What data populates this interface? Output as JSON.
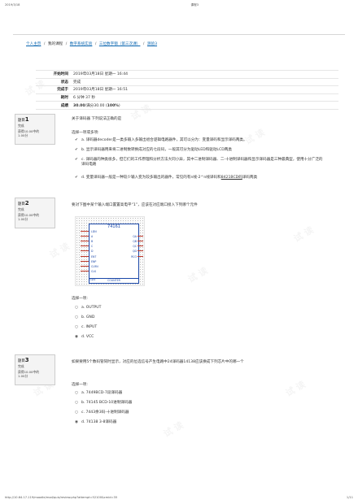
{
  "print": {
    "date": "2019/3/18",
    "doc_title": "课程3",
    "url": "http://10.64.17.119/moodle/mod/quiz/review.php?attempt=52100&cmid=35",
    "page_no": "1/11"
  },
  "breadcrumb": {
    "home": "个人主页",
    "my_courses": "我的课程",
    "course": "数字系统实验",
    "section": "三位数字锁（第三次课）",
    "quiz": "测验3",
    "sep": "/"
  },
  "summary": [
    {
      "label": "开始时间",
      "value": "2019年03月18日 星期一 16:44"
    },
    {
      "label": "状态",
      "value": "完成"
    },
    {
      "label": "完成于",
      "value": "2019年03月18日 星期一 16:51"
    },
    {
      "label": "耗时",
      "value": "6 分钟 37 秒"
    },
    {
      "label": "成绩",
      "value_bold": "30.00",
      "value_mid": "/满分30.00 (",
      "value_pct": "100%",
      "value_end": ")"
    }
  ],
  "questions": [
    {
      "label": "题目",
      "number": "1",
      "state": "完成",
      "score": "获得10.00中的",
      "score2": "1.00分",
      "text": "关于译码器 下列说法正确的是",
      "prompt": "选择一项或多项:",
      "options": [
        {
          "mark": "✔",
          "text": "a. 译码器decoder是一类多输入多输出组合逻辑电路器件，其可以分为：变量译码和显示译码两类。"
        },
        {
          "mark": "✔",
          "text": "b. 显示译码器用来将二进制数转换成对应的七段码，一般其可分为驱动LED和驱动LCD两类"
        },
        {
          "mark": "✔",
          "text": "c. 译码器的种类很多，但它们的工作原理和分析方法大同小异，其中二进制译码器、二-十进制译码器和显示译码器是三种最典型，使用十分广泛的译码电路"
        },
        {
          "mark": "✔",
          "text_pre": "d. 变量译码器一般是一种较少输入变为较多输出的器件，常见的有n线-2^n线译码和",
          "text_ul": "8421BCD码",
          "text_post": "译码两类"
        }
      ]
    },
    {
      "label": "题目",
      "number": "2",
      "state": "完成",
      "score": "获得10.00中的",
      "score2": "1.00分",
      "text": "要对下图中某个输入端口置置高电平“1”，应该在对应端口接入下列哪个元件",
      "chip": {
        "name": "74161",
        "left_pins": [
          "LDN",
          "A",
          "B",
          "C",
          "D",
          "ENT",
          "ENP",
          "CLRN",
          "CLK"
        ],
        "right_pins": [
          "QA",
          "QB",
          "QC",
          "QD",
          "RCO"
        ],
        "footer": "COUNTER",
        "ref": "inst2"
      },
      "prompt": "选择一项:",
      "options": [
        {
          "mark": "○",
          "text": "a. OUTPUT"
        },
        {
          "mark": "○",
          "text": "b. GND"
        },
        {
          "mark": "○",
          "text": "c. INPUT"
        },
        {
          "mark": "◉",
          "text": "d. VCC"
        }
      ]
    },
    {
      "label": "题目",
      "number": "3",
      "state": "完成",
      "score": "获得10.00中的",
      "score2": "1.00分",
      "text": "如果要用5个数码管同时显示，对应的位选信号产生电路中24译码器14138应该换成下列芯片中的哪一个",
      "prompt": "选择一项:",
      "options": [
        {
          "mark": "○",
          "text": "a. 7449BCD-7段译码器"
        },
        {
          "mark": "○",
          "text": "b. 74145 BCD-10进制译码器"
        },
        {
          "mark": "○",
          "text": "c. 7443余3码-十进制译码器"
        },
        {
          "mark": "◉",
          "text": "d. 74138 3-8译码器"
        }
      ]
    }
  ]
}
